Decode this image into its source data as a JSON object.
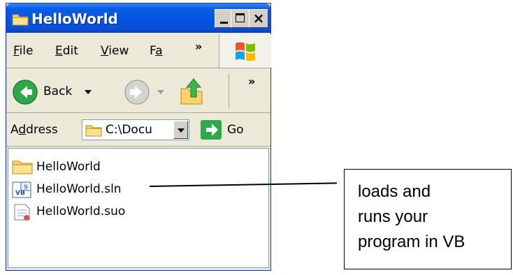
{
  "window": {
    "title": "HelloWorld",
    "controls": {
      "minimize": "minimize",
      "maximize": "maximize",
      "close": "×"
    }
  },
  "menubar": {
    "items": [
      {
        "label": "File",
        "accel": "F"
      },
      {
        "label": "Edit",
        "accel": "E"
      },
      {
        "label": "View",
        "accel": "V"
      },
      {
        "label": "Fa",
        "accel": "a"
      }
    ],
    "overflow": "»"
  },
  "toolbar": {
    "back_label": "Back",
    "overflow": "»"
  },
  "addressbar": {
    "label": "Address",
    "accel": "d",
    "value": "C:\\Docu",
    "go_label": "Go"
  },
  "files": [
    {
      "name": "HelloWorld",
      "icon": "folder-icon"
    },
    {
      "name": "HelloWorld.sln",
      "icon": "vb-solution-icon"
    },
    {
      "name": "HelloWorld.suo",
      "icon": "document-icon"
    }
  ],
  "callout": {
    "text": "loads and\nruns your\nprogram in VB"
  },
  "colors": {
    "titlebar": "#0554e3",
    "window_bg": "#ece9d8",
    "go_green": "#2fa84a"
  }
}
